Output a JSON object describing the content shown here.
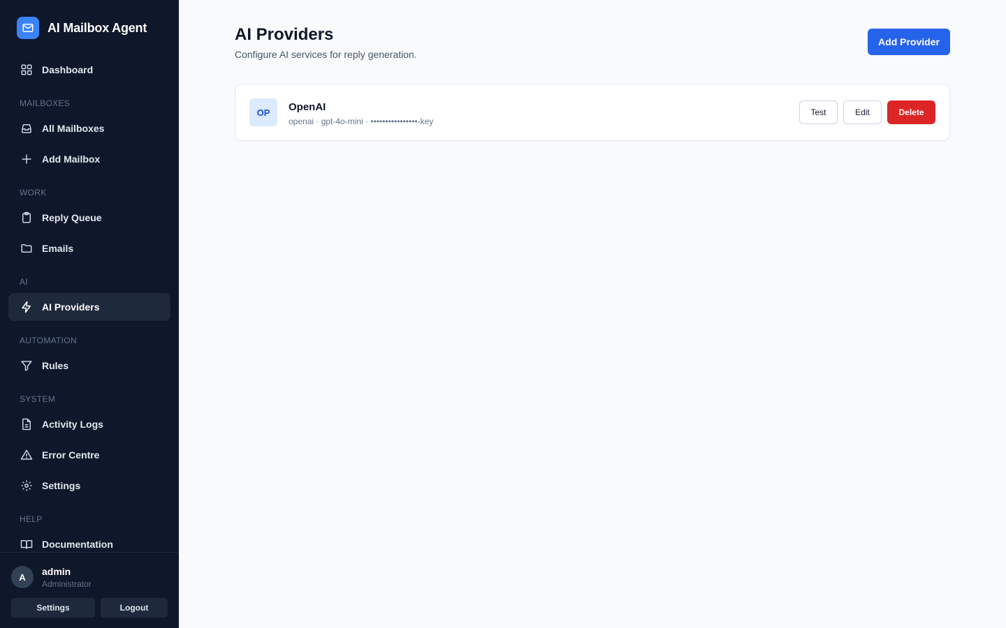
{
  "app": {
    "title": "AI Mailbox Agent",
    "logo_icon": "mail-icon",
    "accent": "#3b82f6"
  },
  "sidebar": {
    "dashboard": {
      "label": "Dashboard",
      "icon": "grid-icon"
    },
    "sections": {
      "mailboxes": "MAILBOXES",
      "work": "WORK",
      "ai": "AI",
      "automation": "AUTOMATION",
      "system": "SYSTEM",
      "help": "HELP"
    },
    "items": {
      "all_mailboxes": {
        "label": "All Mailboxes",
        "icon": "inbox-icon"
      },
      "add_mailbox": {
        "label": "Add Mailbox",
        "icon": "plus-icon"
      },
      "reply_queue": {
        "label": "Reply Queue",
        "icon": "clipboard-icon"
      },
      "emails": {
        "label": "Emails",
        "icon": "folder-icon"
      },
      "ai_providers": {
        "label": "AI Providers",
        "icon": "bolt-icon",
        "active": true
      },
      "rules": {
        "label": "Rules",
        "icon": "filter-icon"
      },
      "activity_logs": {
        "label": "Activity Logs",
        "icon": "file-text-icon"
      },
      "error_centre": {
        "label": "Error Centre",
        "icon": "alert-triangle-icon"
      },
      "settings": {
        "label": "Settings",
        "icon": "gear-icon"
      },
      "documentation": {
        "label": "Documentation",
        "icon": "book-icon"
      }
    },
    "user": {
      "initial": "A",
      "name": "admin",
      "role": "Administrator",
      "settings_label": "Settings",
      "logout_label": "Logout"
    }
  },
  "main": {
    "title": "AI Providers",
    "subtitle": "Configure AI services for reply generation.",
    "add_button": "Add Provider",
    "providers": [
      {
        "badge": "OP",
        "name": "OpenAI",
        "meta": "openai · gpt-4o-mini · ••••••••••••••••-key",
        "test_label": "Test",
        "edit_label": "Edit",
        "delete_label": "Delete"
      }
    ]
  },
  "colors": {
    "sidebar_bg": "#0f172a",
    "primary": "#2563eb",
    "danger": "#dc2626",
    "page_bg": "#f8fafc"
  }
}
